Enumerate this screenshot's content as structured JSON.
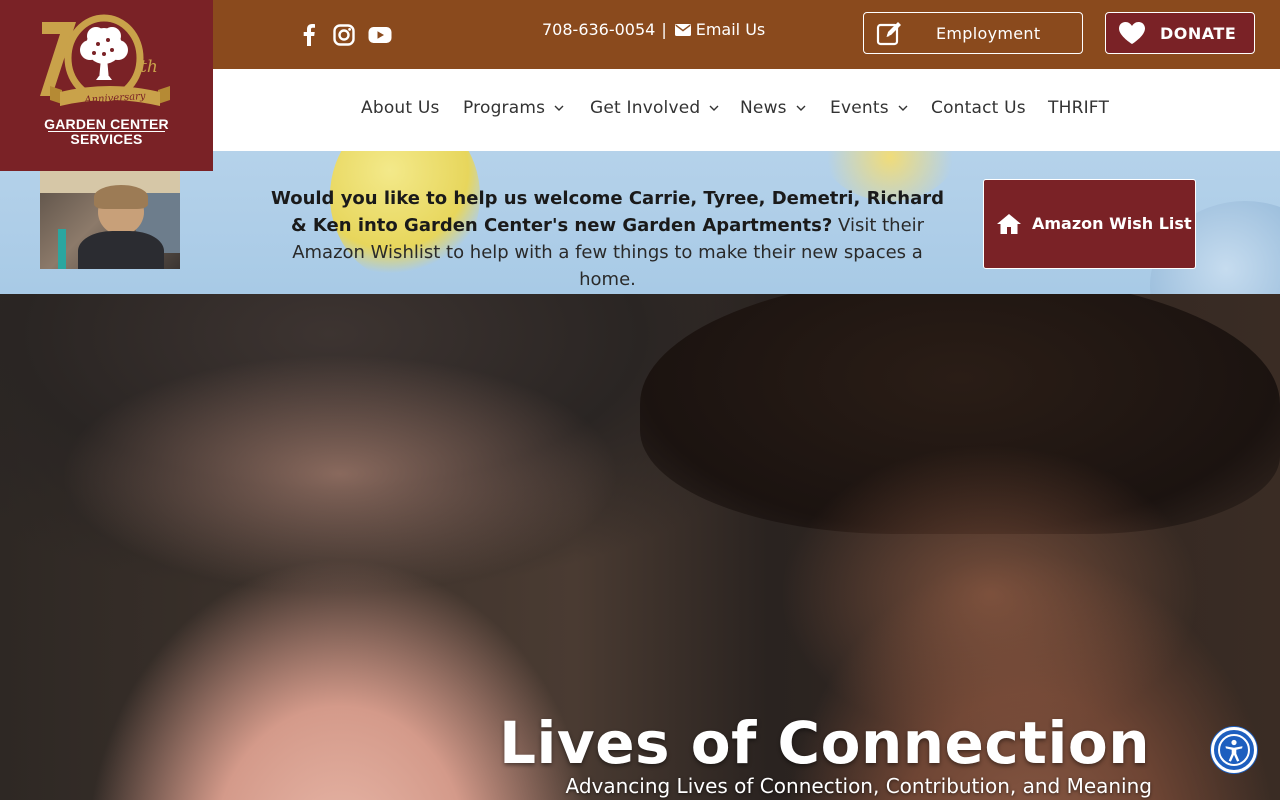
{
  "logo": {
    "anniversary_word": "Anniversary",
    "org_line1": "GARDEN CENTER",
    "org_line2": "SERVICES"
  },
  "topbar": {
    "social": [
      "facebook-icon",
      "instagram-icon",
      "youtube-icon"
    ],
    "phone": "708-636-0054",
    "separator": "|",
    "email_label": "Email Us",
    "employment_label": "Employment",
    "donate_label": "DONATE"
  },
  "nav": {
    "items": [
      {
        "label": "About Us",
        "dropdown": false
      },
      {
        "label": "Programs",
        "dropdown": true
      },
      {
        "label": "Get Involved",
        "dropdown": true
      },
      {
        "label": "News",
        "dropdown": true
      },
      {
        "label": "Events",
        "dropdown": true
      },
      {
        "label": "Contact Us",
        "dropdown": false
      },
      {
        "label": "THRIFT",
        "dropdown": false
      }
    ]
  },
  "banner": {
    "bold_text": "Would you like to help us welcome Carrie, Tyree, Demetri, Richard & Ken into Garden Center's new Garden Apartments?",
    "normal_text": " Visit their Amazon Wishlist to help with a few things to make their new spaces a home.",
    "wishlist_label": "Amazon Wish List"
  },
  "hero": {
    "title": "Lives of Connection",
    "subtitle": "Advancing Lives of Connection, Contribution, and Meaning"
  },
  "colors": {
    "topbar": "#8a4a1d",
    "maroon": "#7a2226",
    "banner": "#aecce8",
    "nav_text": "#333333",
    "accessibility": "#1d5fbf"
  }
}
